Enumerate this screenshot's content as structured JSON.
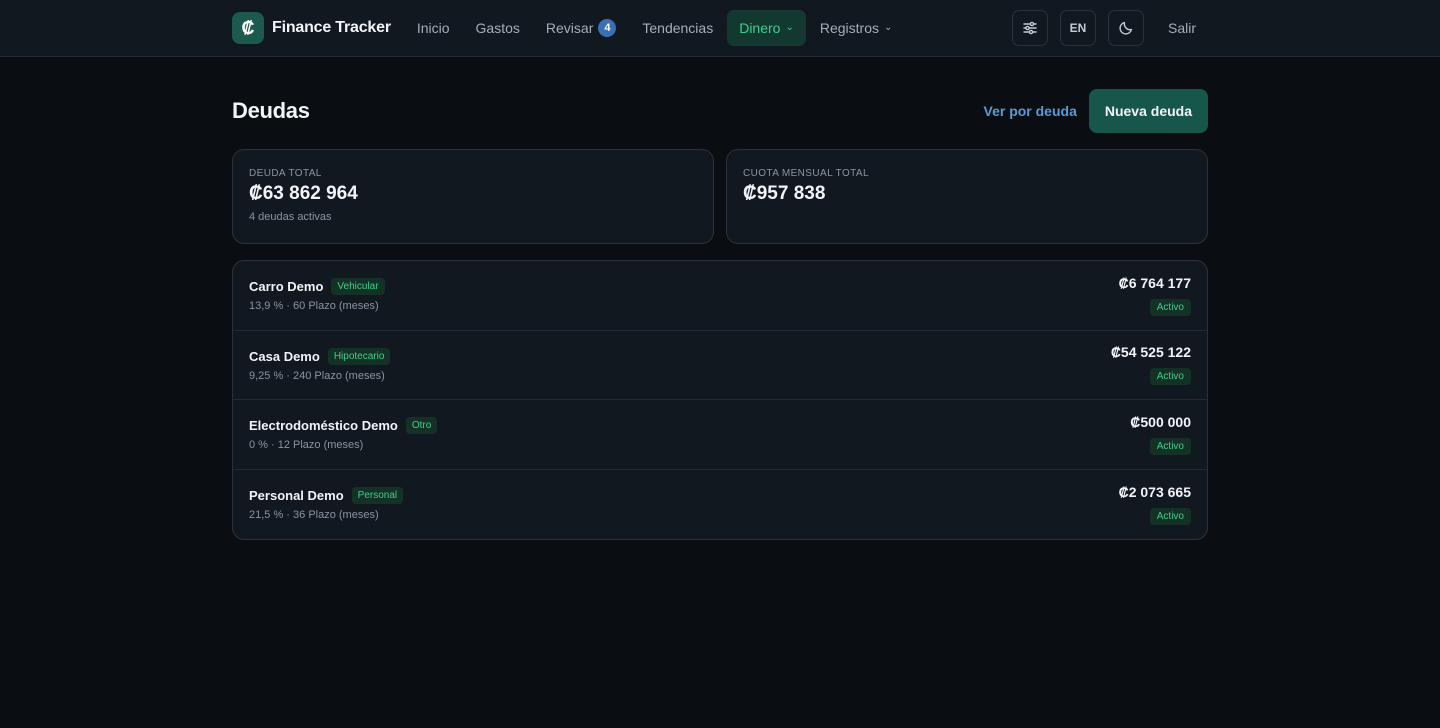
{
  "brand": {
    "logo_glyph": "₡",
    "name": "Finance Tracker"
  },
  "nav": {
    "items": [
      {
        "label": "Inicio"
      },
      {
        "label": "Gastos"
      },
      {
        "label": "Revisar",
        "badge": "4"
      },
      {
        "label": "Tendencias"
      },
      {
        "label": "Dinero",
        "dropdown": true,
        "active": true
      },
      {
        "label": "Registros",
        "dropdown": true
      }
    ]
  },
  "tools": {
    "settings_icon": "sliders-icon",
    "lang_label": "EN",
    "theme_icon": "moon-icon",
    "logout_label": "Salir"
  },
  "page": {
    "title": "Deudas",
    "view_by_label": "Ver por deuda",
    "new_label": "Nueva deuda"
  },
  "stats": {
    "total": {
      "label": "DEUDA TOTAL",
      "value": "₡63 862 964",
      "sub": "4 deudas activas"
    },
    "monthly": {
      "label": "CUOTA MENSUAL TOTAL",
      "value": "₡957 838"
    }
  },
  "debts": [
    {
      "name": "Carro Demo",
      "type": "Vehicular",
      "meta": "13,9 % · 60 Plazo (meses)",
      "amount": "₡6 764 177",
      "status": "Activo"
    },
    {
      "name": "Casa Demo",
      "type": "Hipotecario",
      "meta": "9,25 % · 240 Plazo (meses)",
      "amount": "₡54 525 122",
      "status": "Activo"
    },
    {
      "name": "Electrodoméstico Demo",
      "type": "Otro",
      "meta": "0 % · 12 Plazo (meses)",
      "amount": "₡500 000",
      "status": "Activo"
    },
    {
      "name": "Personal Demo",
      "type": "Personal",
      "meta": "21,5 % · 36 Plazo (meses)",
      "amount": "₡2 073 665",
      "status": "Activo"
    }
  ],
  "colors": {
    "accent": "#3ecf8e",
    "primary_button": "#17574b",
    "link": "#5b9ad6",
    "badge": "#3a6fb6"
  }
}
